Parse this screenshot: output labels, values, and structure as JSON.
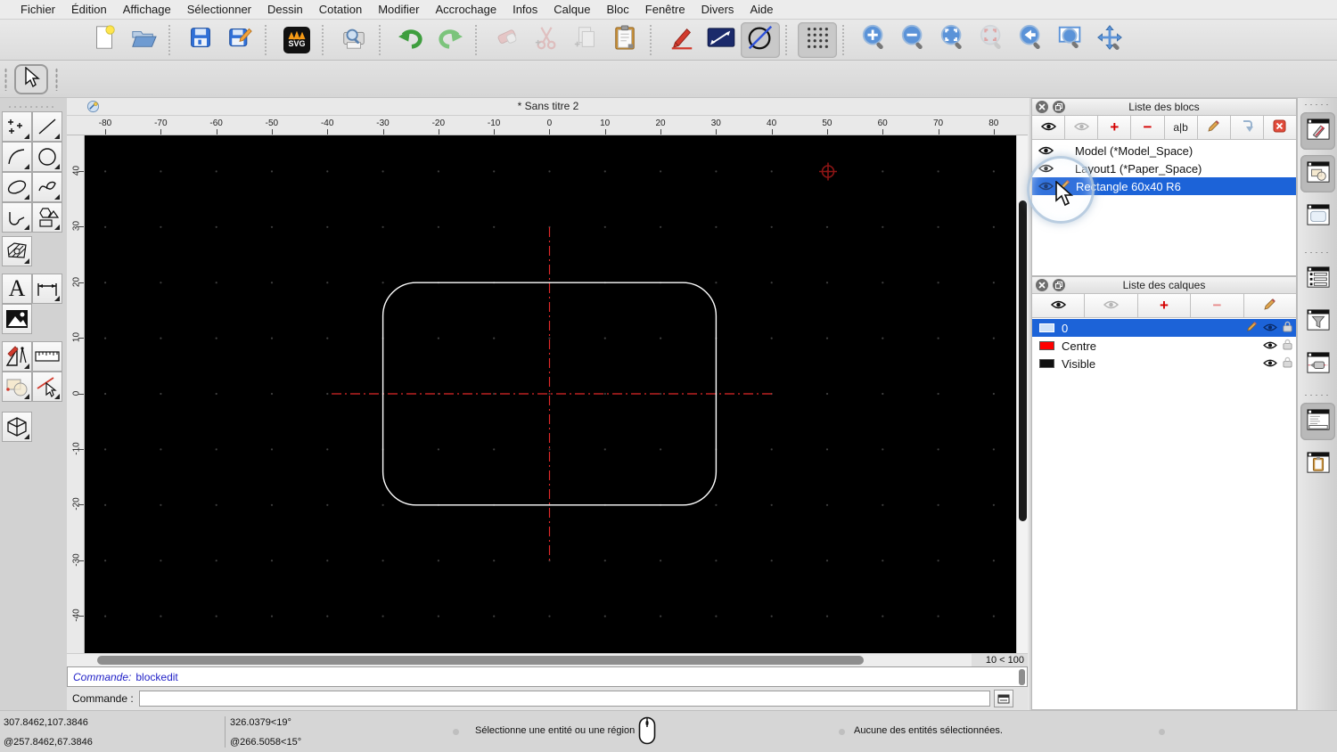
{
  "menu": {
    "items": [
      "Fichier",
      "Édition",
      "Affichage",
      "Sélectionner",
      "Dessin",
      "Cotation",
      "Modifier",
      "Accrochage",
      "Infos",
      "Calque",
      "Bloc",
      "Fenêtre",
      "Divers",
      "Aide"
    ]
  },
  "window": {
    "title": "* Sans titre 2"
  },
  "toolbar": {
    "svg_label": "SVG"
  },
  "glyphs": {
    "plus": "+",
    "minus": "−",
    "ab": "a|b",
    "text_tool": "A"
  },
  "rulers": {
    "h_ticks": [
      "-80",
      "-70",
      "-60",
      "-50",
      "-40",
      "-30",
      "-20",
      "-10",
      "0",
      "10",
      "20",
      "30",
      "40",
      "50",
      "60",
      "70",
      "80"
    ],
    "v_ticks": [
      "40",
      "30",
      "20",
      "10",
      "0",
      "-10",
      "-20",
      "-30",
      "-40"
    ]
  },
  "blocks_panel": {
    "title": "Liste des blocs",
    "items": [
      {
        "label": "Model (*Model_Space)"
      },
      {
        "label": "Layout1 (*Paper_Space)"
      },
      {
        "label": "Rectangle 60x40 R6"
      }
    ]
  },
  "layers_panel": {
    "title": "Liste des calques",
    "layers": [
      {
        "name": "0",
        "swatch": "#cfe2f8"
      },
      {
        "name": "Centre",
        "swatch": "#ff0000"
      },
      {
        "name": "Visible",
        "swatch": "#111111"
      }
    ]
  },
  "zoom_indicator": "10 < 100",
  "command": {
    "history_prefix": "Commande:",
    "history_value": "blockedit",
    "prompt": "Commande :",
    "input_value": ""
  },
  "status": {
    "abs": "307.8462,107.3846",
    "rel": "@257.8462,67.3846",
    "polar_abs": "326.0379<19°",
    "polar_rel": "@266.5058<15°",
    "hint": "Sélectionne une entité ou une région",
    "selection_info": "Aucune des entités sélectionnées."
  },
  "colors": {
    "selection": "#1c63d8",
    "crosshair": "#e02828",
    "entity": "#ffffff"
  }
}
